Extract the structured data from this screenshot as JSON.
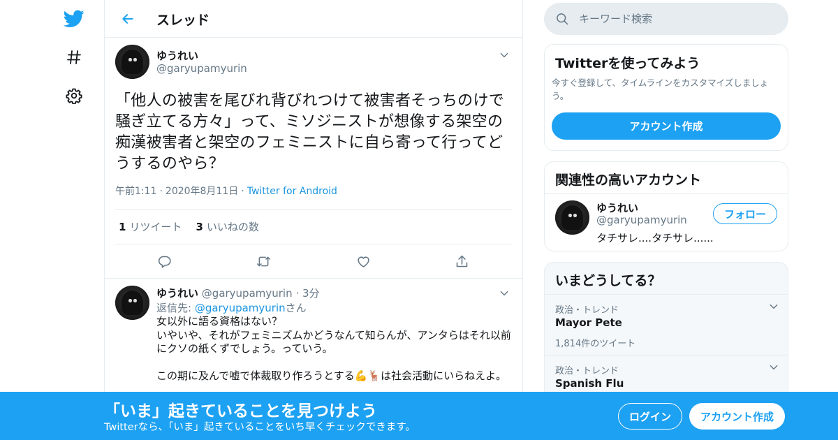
{
  "header": {
    "title": "スレッド"
  },
  "tweet": {
    "author_name": "ゆうれい",
    "author_handle": "@garyupamyurin",
    "text": "「他人の被害を尾びれ背びれつけて被害者そっちのけで騒ぎ立てる方々」って、ミソジニストが想像する架空の痴漢被害者と架空のフェミニストに自ら寄って行ってどうするのやら？",
    "time": "午前1:11",
    "date": "2020年8月11日",
    "source": "Twitter for Android",
    "retweet_count": "1",
    "retweet_label": "リツイート",
    "like_count": "3",
    "like_label": "いいねの数"
  },
  "reply": {
    "author_name": "ゆうれい",
    "author_handle": "@garyupamyurin",
    "time": "3分",
    "reply_to_prefix": "返信先: ",
    "reply_to_handle": "@garyupamyurin",
    "reply_to_suffix": "さん",
    "text": "女以外に語る資格はない？\nいやいや、それがフェミニズムかどうなんて知らんが、アンタらはそれ以前にクソの紙くずでしょう。っていう。\n\nこの期に及んで嘘で体裁取り作ろうとする💪🦌は社会活動にいらねえよ。"
  },
  "search": {
    "placeholder": "キーワード検索"
  },
  "signup_card": {
    "title": "Twitterを使ってみよう",
    "description": "今すぐ登録して、タイムラインをカスタマイズしましょう。",
    "button": "アカウント作成"
  },
  "related_card": {
    "title": "関連性の高いアカウント",
    "name": "ゆうれい",
    "handle": "@garyupamyurin",
    "bio": "タチサレ....タチサレ......",
    "follow_button": "フォロー"
  },
  "trends_card": {
    "title": "いまどうしてる？",
    "items": [
      {
        "category": "政治・トレンド",
        "name": "Mayor Pete",
        "count": "1,814件のツイート"
      },
      {
        "category": "政治・トレンド",
        "name": "Spanish Flu"
      }
    ]
  },
  "banner": {
    "headline": "「いま」起きていることを見つけよう",
    "sub": "Twitterなら、「いま」起きていることをいち早くチェックできます。",
    "login_button": "ログイン",
    "signup_button": "アカウント作成"
  },
  "colors": {
    "accent": "#1da1f2",
    "link": "#1b95e0",
    "secondary_text": "#657786",
    "border": "#e6ecf0"
  },
  "icons": [
    "twitter-bird-icon",
    "hashtag-icon",
    "gear-icon",
    "back-arrow-icon",
    "chevron-down-icon",
    "reply-icon",
    "retweet-icon",
    "like-icon",
    "share-icon",
    "search-icon"
  ]
}
